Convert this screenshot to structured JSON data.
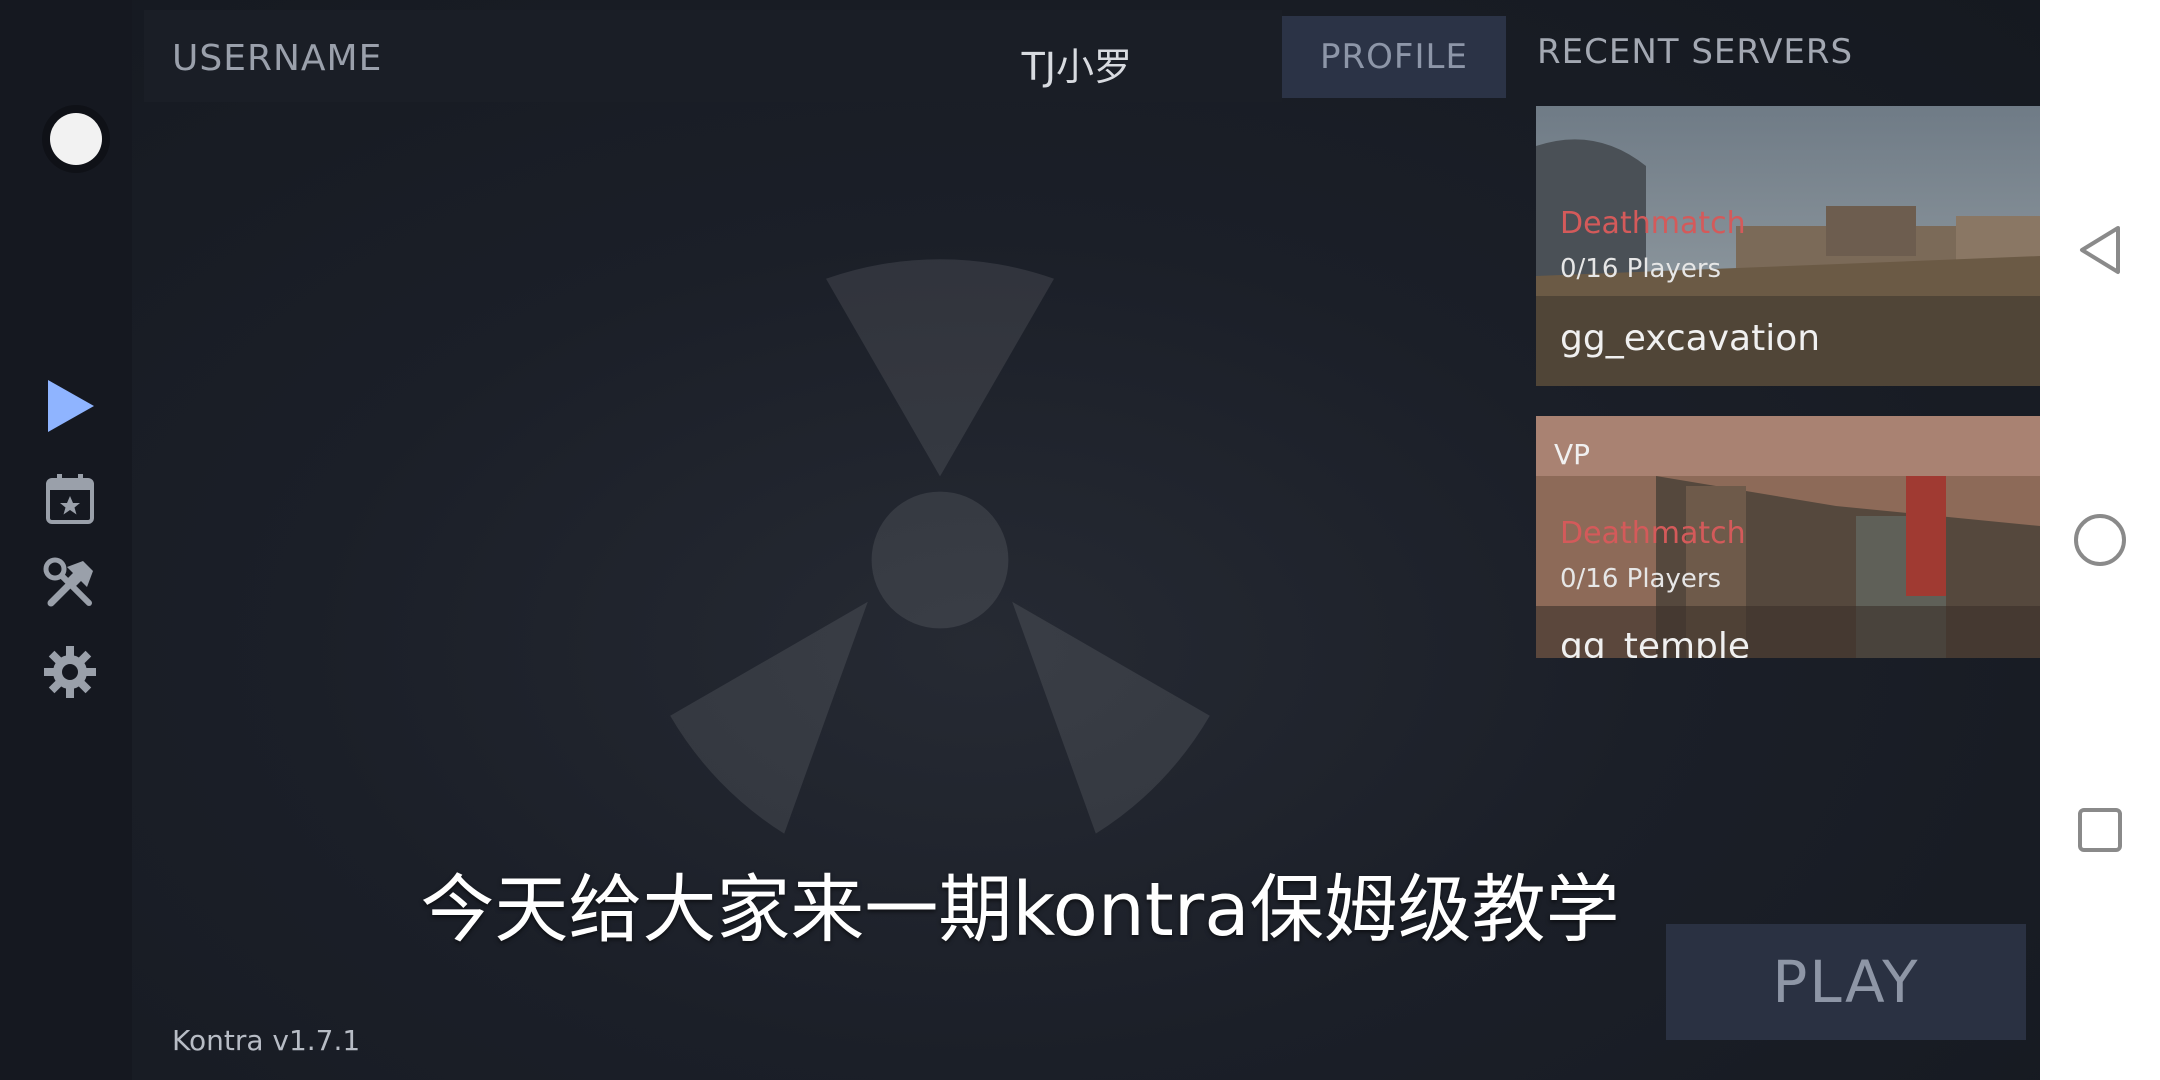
{
  "topbar": {
    "username_label": "USERNAME",
    "username_value": "TJ小罗",
    "profile_label": "PROFILE"
  },
  "recent_servers": {
    "title": "RECENT SERVERS",
    "items": [
      {
        "tag": "",
        "mode": "Deathmatch",
        "players": "0/16  Players",
        "name": "gg_excavation"
      },
      {
        "tag": "VP",
        "mode": "Deathmatch",
        "players": "0/16  Players",
        "name": "gg_temple"
      }
    ]
  },
  "sidebar": {
    "icons": [
      "avatar",
      "play-icon",
      "calendar-star-icon",
      "tools-icon",
      "gear-icon"
    ]
  },
  "subtitle": "今天给大家来一期kontra保姆级教学",
  "play_label": "PLAY",
  "version": "Kontra v1.7.1",
  "colors": {
    "accent_play": "#8fb4ff",
    "mode_red": "#d45a5a",
    "panel": "#2a3142"
  },
  "android_nav": {
    "icons": [
      "back-icon",
      "home-icon",
      "recents-icon"
    ]
  }
}
